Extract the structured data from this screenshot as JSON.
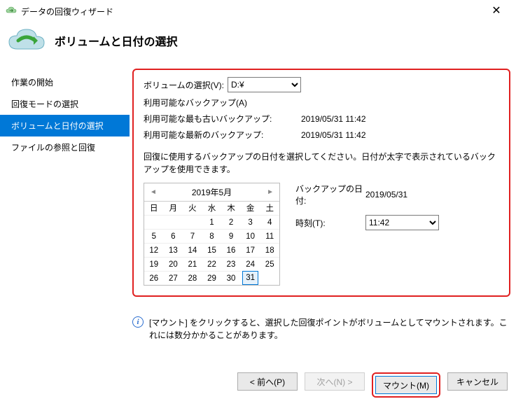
{
  "window": {
    "title": "データの回復ウィザード",
    "close_glyph": "✕"
  },
  "page": {
    "heading": "ボリュームと日付の選択"
  },
  "sidebar": {
    "items": [
      {
        "label": "作業の開始"
      },
      {
        "label": "回復モードの選択"
      },
      {
        "label": "ボリュームと日付の選択"
      },
      {
        "label": "ファイルの参照と回復"
      }
    ],
    "selected_index": 2
  },
  "volume": {
    "label": "ボリュームの選択(V):",
    "value": "D:¥"
  },
  "backup": {
    "available_label": "利用可能なバックアップ(A)",
    "oldest_label": "利用可能な最も古いバックアップ:",
    "oldest_value": "2019/05/31 11:42",
    "newest_label": "利用可能な最新のバックアップ:",
    "newest_value": "2019/05/31 11:42"
  },
  "instruction": "回復に使用するバックアップの日付を選択してください。日付が太字で表示されているバックアップを使用できます。",
  "calendar": {
    "month_label": "2019年5月",
    "prev": "◄",
    "next": "►",
    "dow": [
      "日",
      "月",
      "火",
      "水",
      "木",
      "金",
      "土"
    ],
    "blanks": 3,
    "days": [
      "1",
      "2",
      "3",
      "4",
      "5",
      "6",
      "7",
      "8",
      "9",
      "10",
      "11",
      "12",
      "13",
      "14",
      "15",
      "16",
      "17",
      "18",
      "19",
      "20",
      "21",
      "22",
      "23",
      "24",
      "25",
      "26",
      "27",
      "28",
      "29",
      "30",
      "31"
    ],
    "selected_day": "31"
  },
  "detail": {
    "date_label": "バックアップの日付:",
    "date_value": "2019/05/31",
    "time_label": "時刻(T):",
    "time_value": "11:42"
  },
  "info": {
    "text": "[マウント] をクリックすると、選択した回復ポイントがボリュームとしてマウントされます。これには数分かかることがあります。"
  },
  "buttons": {
    "back": "< 前へ(P)",
    "next": "次へ(N) >",
    "mount": "マウント(M)",
    "cancel": "キャンセル"
  }
}
